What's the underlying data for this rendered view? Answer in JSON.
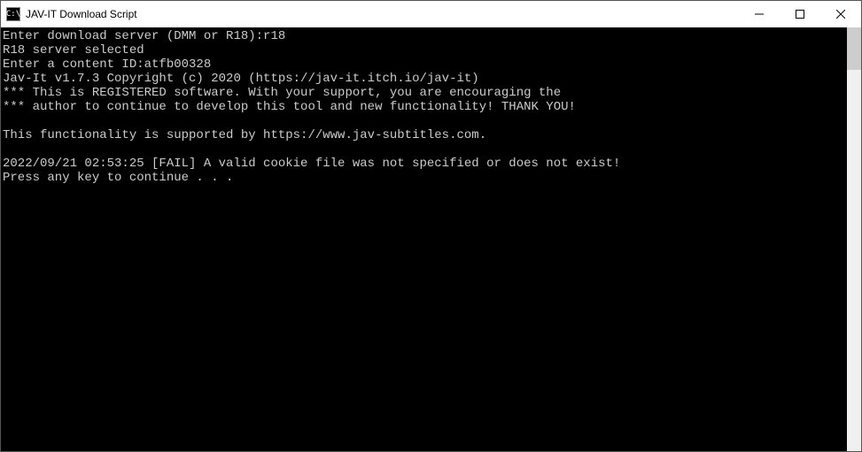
{
  "window": {
    "icon_text": "C:\\",
    "title": "JAV-IT Download Script"
  },
  "console": {
    "lines": [
      "Enter download server (DMM or R18):r18",
      "R18 server selected",
      "Enter a content ID:atfb00328",
      "Jav-It v1.7.3 Copyright (c) 2020 (https://jav-it.itch.io/jav-it)",
      "*** This is REGISTERED software. With your support, you are encouraging the",
      "*** author to continue to develop this tool and new functionality! THANK YOU!",
      "",
      "This functionality is supported by https://www.jav-subtitles.com.",
      "",
      "2022/09/21 02:53:25 [FAIL] A valid cookie file was not specified or does not exist!",
      "Press any key to continue . . ."
    ]
  }
}
